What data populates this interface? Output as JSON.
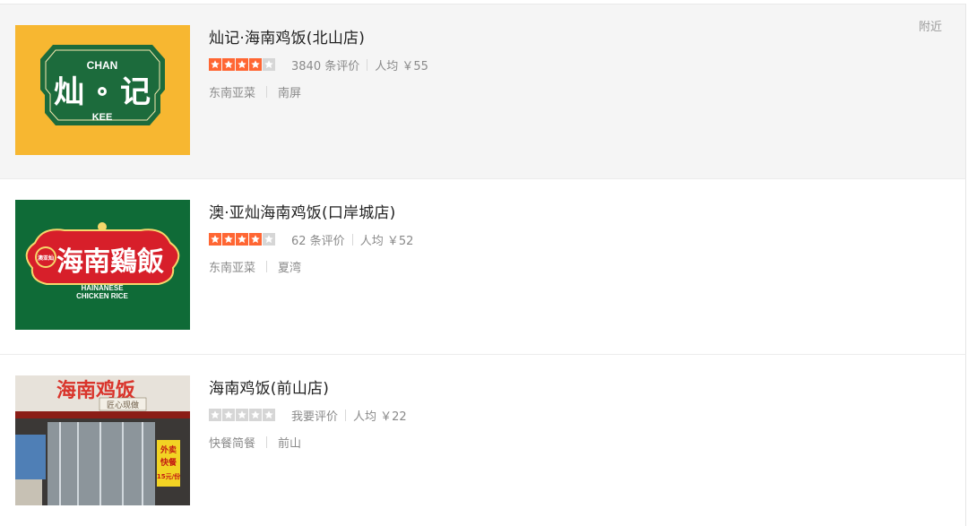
{
  "nearby_label": "附近",
  "restaurants": [
    {
      "name": "灿记·海南鸡饭(北山店)",
      "rating_stars": 4,
      "reviews": "3840 条评价",
      "avg_price": "人均 ￥55",
      "cuisine": "东南亚菜",
      "area": "南屏",
      "logo": {
        "top": "CHAN",
        "main_left": "灿",
        "main_right": "记",
        "bottom": "KEE"
      }
    },
    {
      "name": "澳·亚灿海南鸡饭(口岸城店)",
      "rating_stars": 4,
      "reviews": "62 条评价",
      "avg_price": "人均 ￥52",
      "cuisine": "东南亚菜",
      "area": "夏湾",
      "logo": {
        "badge": "澳亚灿",
        "main": "海南鷄飯",
        "sub1": "HAINANESE",
        "sub2": "CHICKEN RICE"
      }
    },
    {
      "name": "海南鸡饭(前山店)",
      "rating_stars": 0,
      "reviews": "我要评价",
      "avg_price": "人均 ￥22",
      "cuisine": "快餐简餐",
      "area": "前山",
      "photo": {
        "sign": "海南鸡饭",
        "motto": "匠心现做",
        "poster1": "外卖",
        "poster2": "快餐",
        "poster3": "15元/份"
      }
    }
  ],
  "colors": {
    "star_on": "#ff6633",
    "star_off": "#d6d6d6",
    "chan_bg": "#f7b731",
    "chan_green": "#1c6b3c",
    "ao_bg": "#0f6b37",
    "ao_red": "#d71f2a"
  }
}
